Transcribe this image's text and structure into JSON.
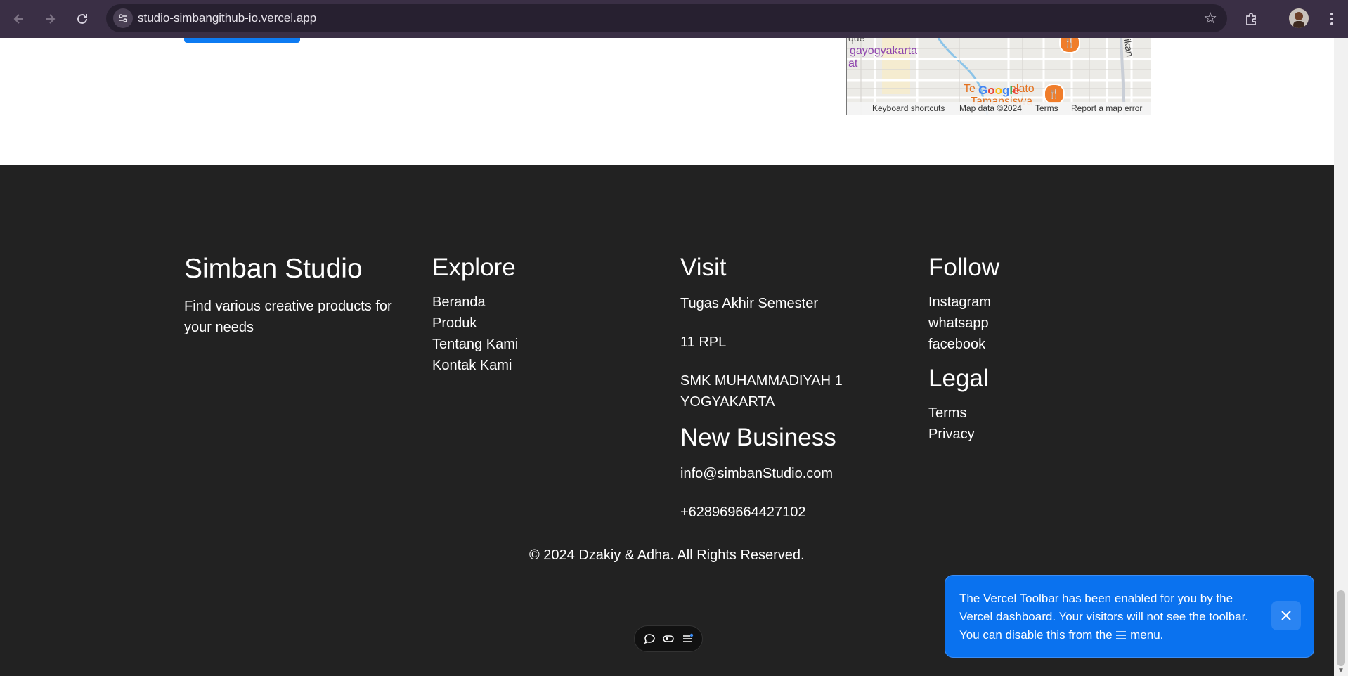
{
  "browser": {
    "url": "studio-simbangithub-io.vercel.app"
  },
  "map": {
    "labels": [
      "gayogyakarta",
      "at",
      "que",
      "ikan"
    ],
    "poi": [
      "Te",
      "elato",
      "Tamansiswa"
    ],
    "google_logo": "Google",
    "footer": {
      "shortcuts": "Keyboard shortcuts",
      "data": "Map data ©2024",
      "terms": "Terms",
      "report": "Report a map error"
    }
  },
  "footer": {
    "brand": "Simban Studio",
    "tagline": "Find various creative products for your needs",
    "explore": {
      "title": "Explore",
      "links": [
        "Beranda",
        "Produk",
        "Tentang Kami",
        "Kontak Kami"
      ]
    },
    "visit": {
      "title": "Visit",
      "lines": [
        "Tugas Akhir Semester",
        "11 RPL",
        "SMK MUHAMMADIYAH 1 YOGYAKARTA"
      ]
    },
    "new_business": {
      "title": "New Business",
      "email": "info@simbanStudio.com",
      "phone": "+628969664427102"
    },
    "follow": {
      "title": "Follow",
      "links": [
        "Instagram",
        "whatsapp",
        "facebook"
      ]
    },
    "legal": {
      "title": "Legal",
      "links": [
        "Terms",
        "Privacy"
      ]
    },
    "copyright": "© 2024 Dzakiy & Adha. All Rights Reserved."
  },
  "vercel_toast": {
    "text_before": "The Vercel Toolbar has been enabled for you by the Vercel dashboard. Your visitors will not see the toolbar. You can disable this from the",
    "menu_icon": "menu-icon",
    "text_after": "menu."
  },
  "colors": {
    "footer_bg": "#222222",
    "toast_bg": "#0a72ef",
    "accent_button": "#0d7bf2",
    "browser_chrome": "#3a2f45"
  }
}
